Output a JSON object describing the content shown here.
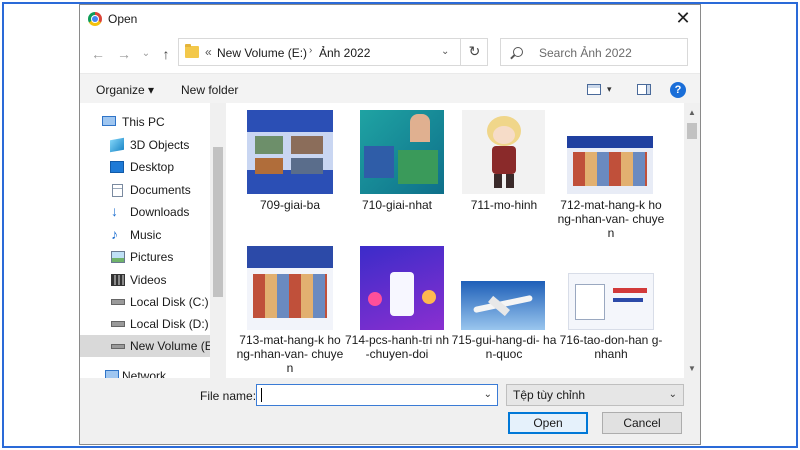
{
  "window": {
    "title": "Open",
    "close_glyph": "✕"
  },
  "nav_buttons": {
    "back": "←",
    "forward": "→",
    "up": "↑",
    "recent": "⌄"
  },
  "address": {
    "sep": "«",
    "path": [
      "New Volume (E:)",
      "Ảnh 2022"
    ],
    "arrow": "›",
    "dropdown": "⌄",
    "refresh": "↻"
  },
  "search": {
    "placeholder": "Search Ảnh 2022"
  },
  "toolbar": {
    "organize": "Organize ▾",
    "new_folder": "New folder",
    "help": "?",
    "view_dd": "▾"
  },
  "nav": {
    "items": [
      {
        "label": "This PC",
        "icon": "computer-icon"
      },
      {
        "label": "3D Objects",
        "icon": "cube-icon"
      },
      {
        "label": "Desktop",
        "icon": "desktop-icon"
      },
      {
        "label": "Documents",
        "icon": "document-icon"
      },
      {
        "label": "Downloads",
        "icon": "download-icon"
      },
      {
        "label": "Music",
        "icon": "music-icon"
      },
      {
        "label": "Pictures",
        "icon": "pictures-icon"
      },
      {
        "label": "Videos",
        "icon": "video-icon"
      },
      {
        "label": "Local Disk (C:)",
        "icon": "drive-icon"
      },
      {
        "label": "Local Disk (D:)",
        "icon": "drive-icon"
      },
      {
        "label": "New Volume (E:)",
        "icon": "drive-icon",
        "selected": true
      },
      {
        "label": "Network",
        "icon": "network-icon"
      }
    ]
  },
  "files": [
    {
      "name": "709-giai-ba",
      "thumb": "contest-blue"
    },
    {
      "name": "710-giai-nhat",
      "thumb": "contest-teal"
    },
    {
      "name": "711-mo-hinh",
      "thumb": "figure-photo"
    },
    {
      "name": "712-mat-hang-k hong-nhan-van- chuyen",
      "thumb": "banner-small"
    },
    {
      "name": "713-mat-hang-k hong-nhan-van- chuyen",
      "thumb": "banner"
    },
    {
      "name": "714-pcs-hanh-tri nh-chuyen-doi",
      "thumb": "purple-promo"
    },
    {
      "name": "715-gui-hang-di- han-quoc",
      "thumb": "airplane"
    },
    {
      "name": "716-tao-don-han g-nhanh",
      "thumb": "white-promo"
    }
  ],
  "bottom": {
    "file_name_label": "File name:",
    "file_name_value": "",
    "file_type": "Tệp tùy chỉnh",
    "dropdown": "⌄",
    "open": "Open",
    "cancel": "Cancel"
  },
  "colors": {
    "accent": "#0078d7",
    "frame": "#2a6ad8"
  }
}
